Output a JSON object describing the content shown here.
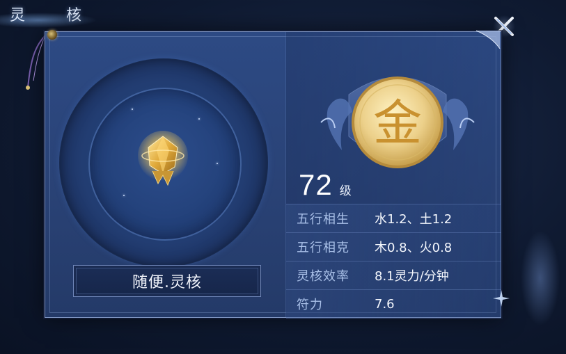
{
  "screen": {
    "title": "灵 核"
  },
  "core": {
    "name": "随便.灵核",
    "element_glyph": "金",
    "element_icon": "metal-element-emblem-icon"
  },
  "level": {
    "number": "72",
    "unit": "级"
  },
  "stats": [
    {
      "label": "五行相生",
      "value": "水1.2、土1.2"
    },
    {
      "label": "五行相克",
      "value": "木0.8、火0.8"
    },
    {
      "label": "灵核效率",
      "value": "8.1灵力/分钟"
    },
    {
      "label": "符力",
      "value": "7.6"
    }
  ],
  "colors": {
    "panel": "#2a4377",
    "gold": "#e3c56a",
    "accent_text": "#a9c0e8"
  }
}
